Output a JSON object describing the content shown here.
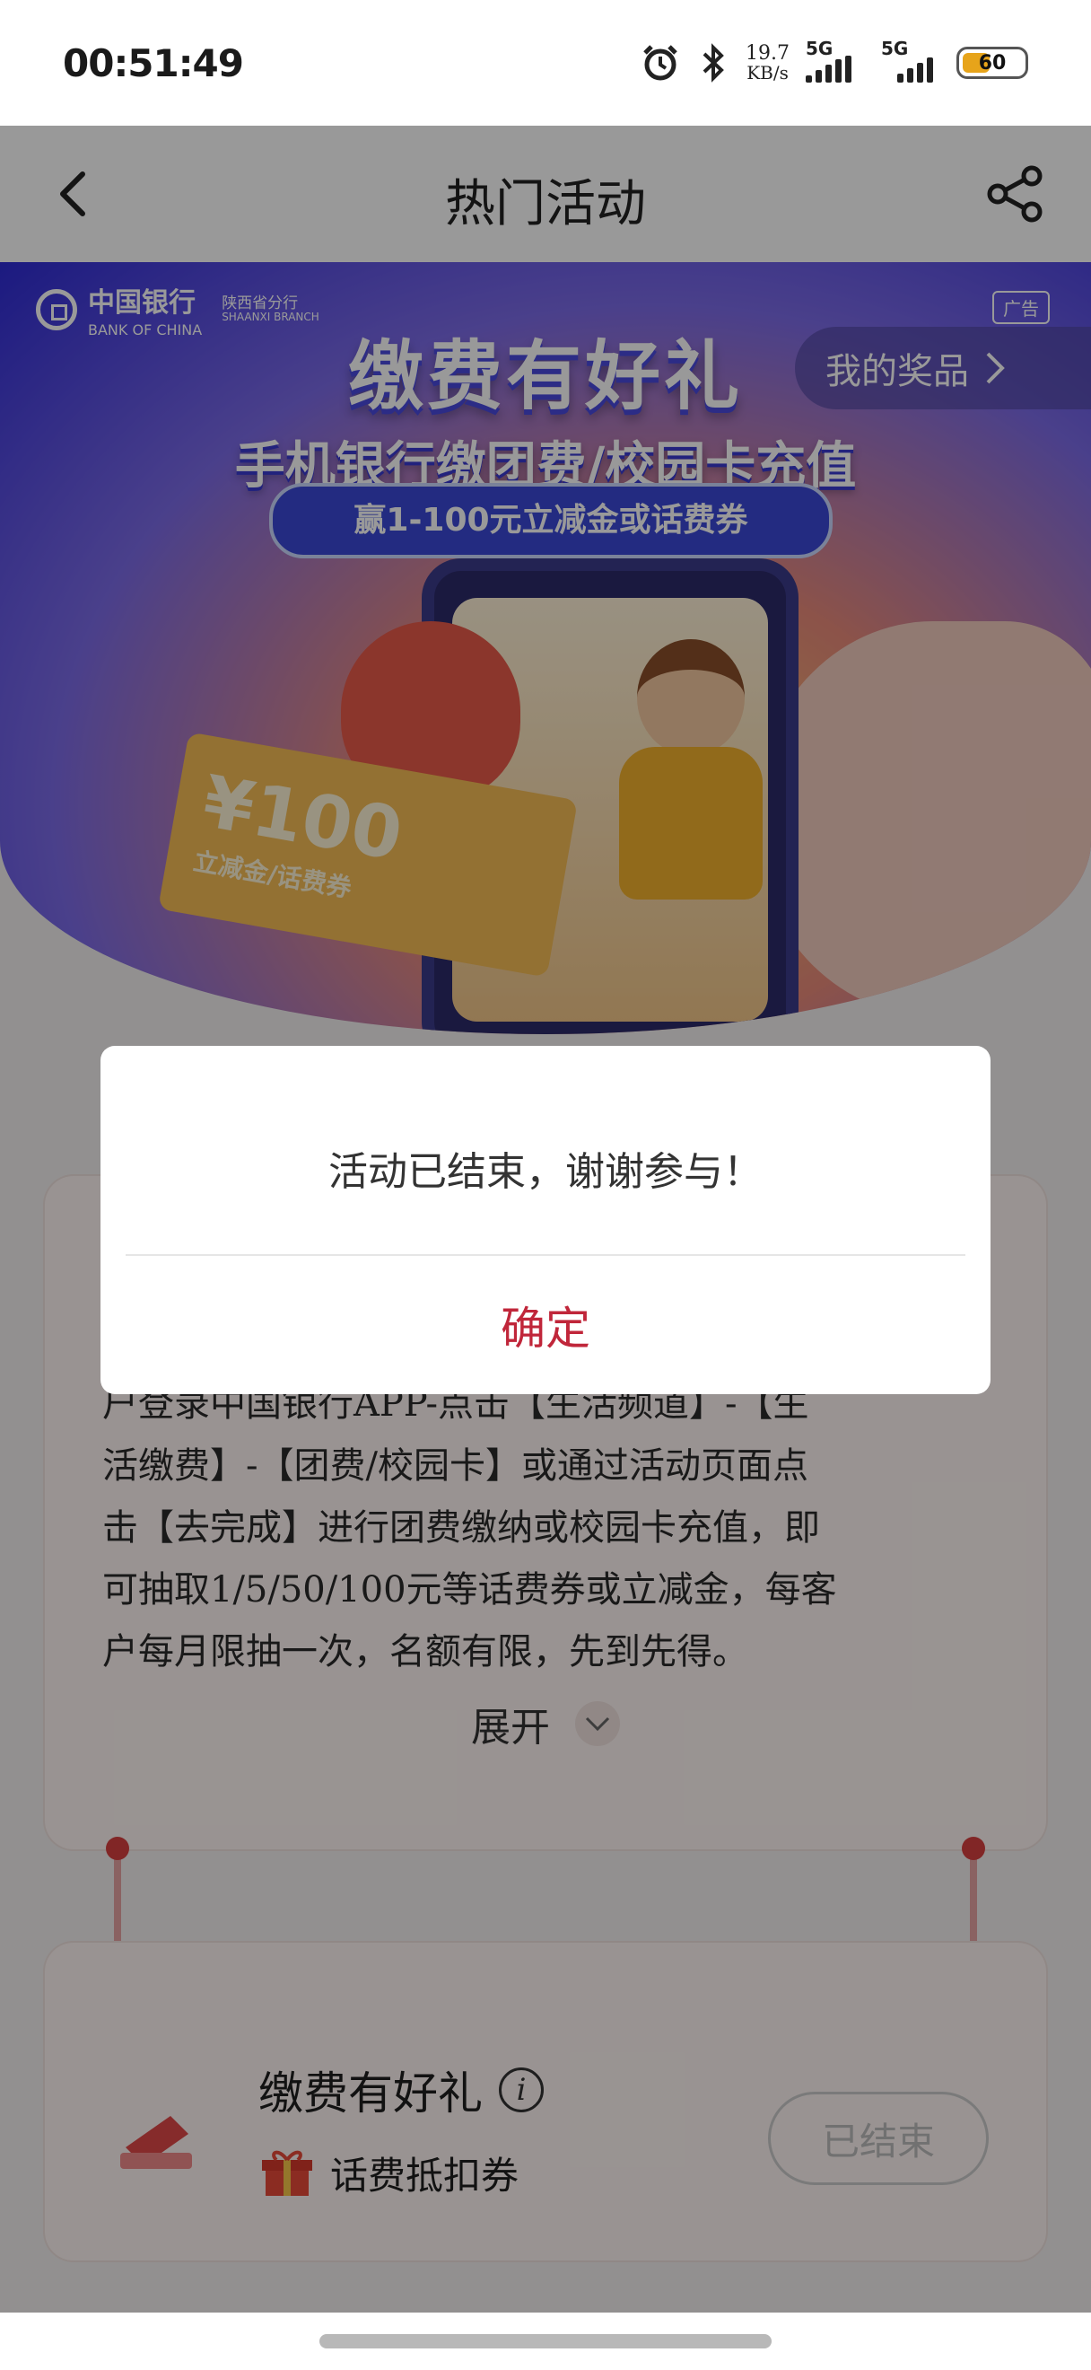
{
  "status_bar": {
    "time": "00:51:49",
    "net_speed_value": "19.7",
    "net_speed_unit": "KB/s",
    "sim1_label": "5G",
    "sim2_label": "5G",
    "battery_level": "60"
  },
  "nav": {
    "title": "热门活动"
  },
  "banner": {
    "bank_name_cn": "中国银行",
    "bank_name_en": "BANK OF CHINA",
    "branch_cn": "陕西省分行",
    "branch_en": "SHAANXI BRANCH",
    "ad_tag": "广告",
    "my_prizes": "我的奖品",
    "headline": "缴费有好礼",
    "subheadline": "手机银行缴团费/校园卡充值",
    "pill_text": "赢1-100元立减金或话费券",
    "coupon_amount": "¥100",
    "coupon_label": "立减金/话费券"
  },
  "activity_card": {
    "description_lines": [
      "户登录中国银行APP-点击【生活频道】-【生",
      "活缴费】-【团费/校园卡】或通过活动页面点",
      "击【去完成】进行团费缴纳或校园卡充值，即",
      "可抽取1/5/50/100元等话费券或立减金，每客",
      "户每月限抽一次，名额有限，先到先得。"
    ],
    "expand_label": "展开"
  },
  "prize_card": {
    "title": "缴费有好礼",
    "subtitle": "话费抵扣券",
    "status_button": "已结束"
  },
  "dialog": {
    "message": "活动已结束，谢谢参与！",
    "confirm_label": "确定"
  },
  "colors": {
    "accent_red": "#c0263a",
    "overlay": "rgba(0,0,0,0.40)"
  },
  "icons": {
    "back": "chevron-left-icon",
    "share": "share-icon",
    "alarm": "alarm-icon",
    "bluetooth": "bluetooth-icon",
    "info": "info-icon",
    "gift": "gift-icon",
    "expand": "chevron-down-icon"
  }
}
